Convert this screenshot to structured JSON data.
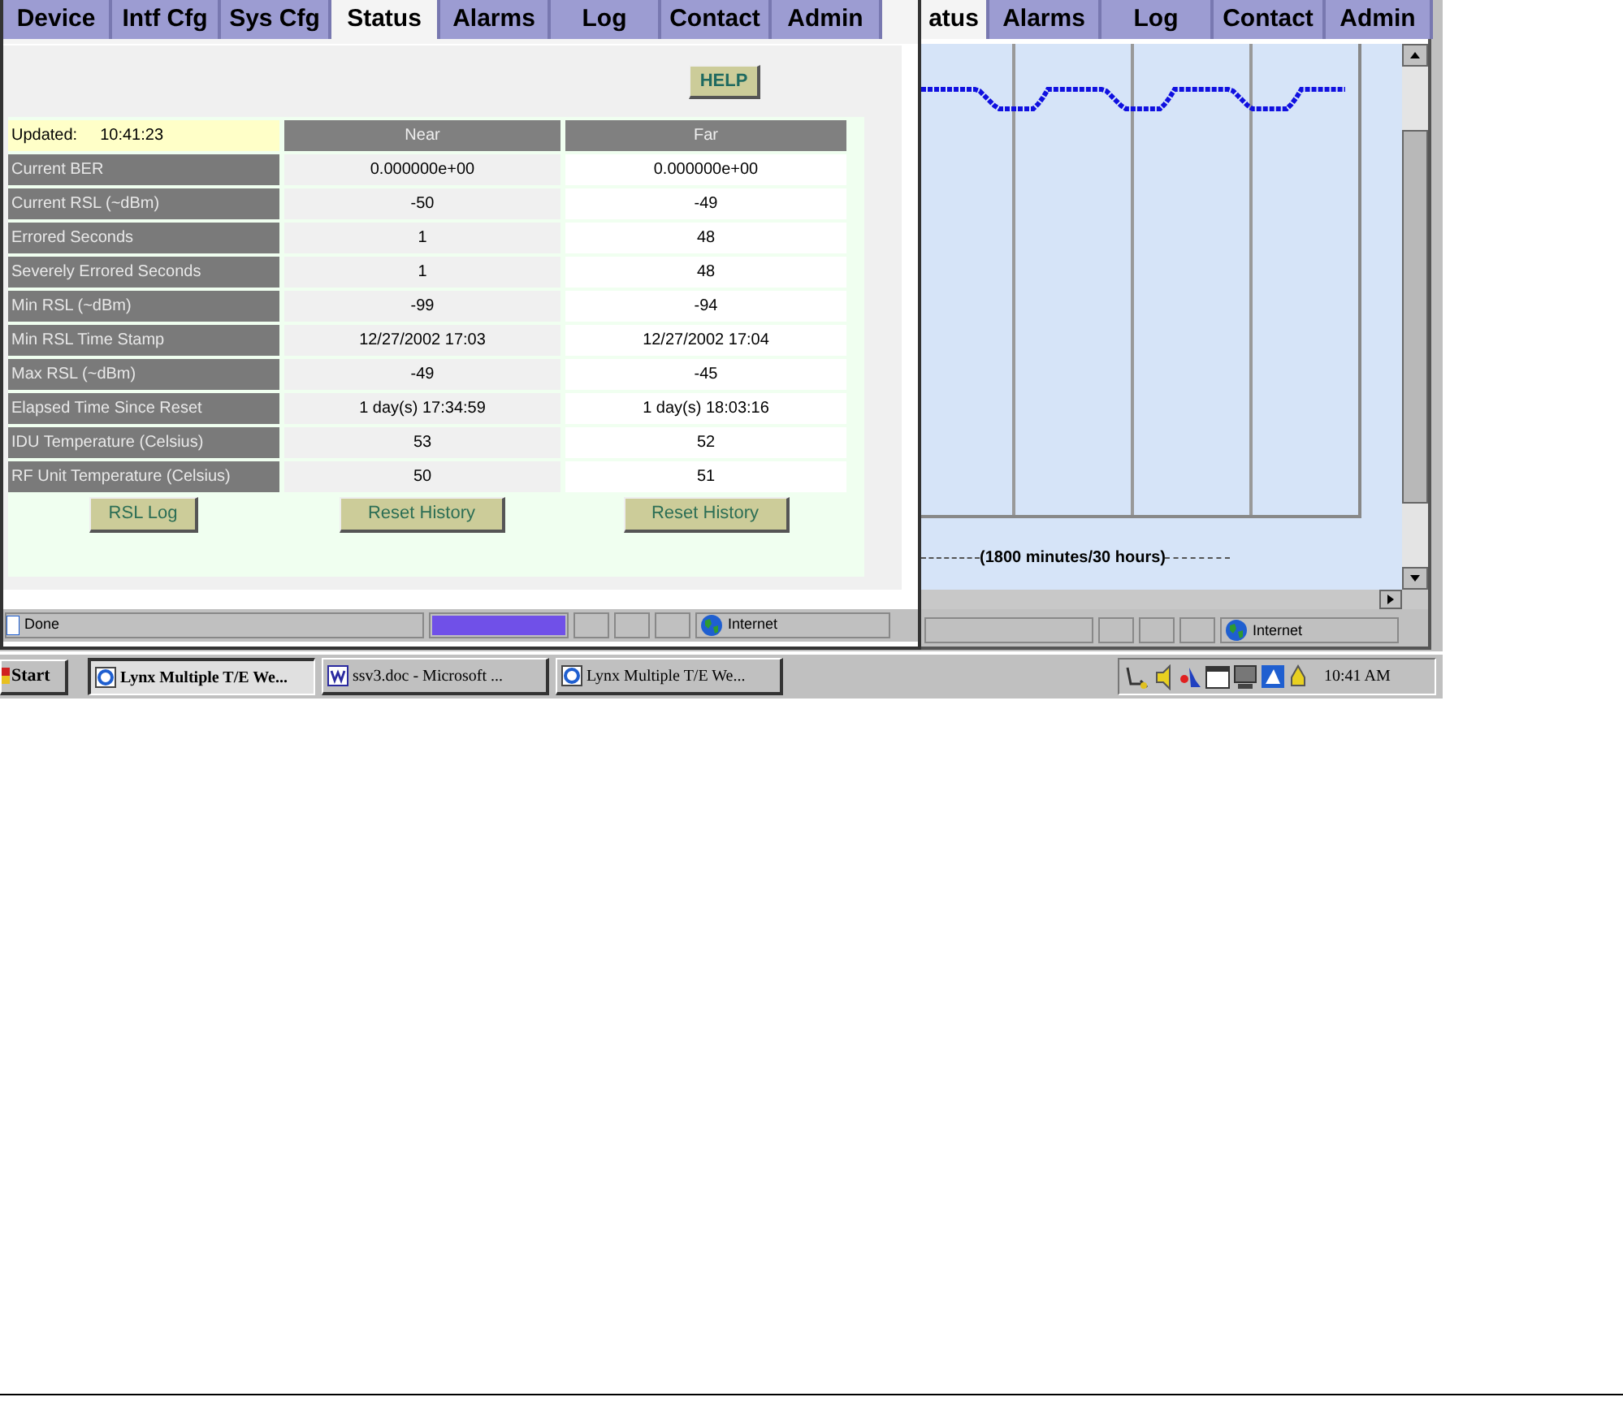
{
  "front_window": {
    "tabs": [
      {
        "label": "Device",
        "selected": false
      },
      {
        "label": "Intf Cfg",
        "selected": false
      },
      {
        "label": "Sys Cfg",
        "selected": false
      },
      {
        "label": "Status",
        "selected": true
      },
      {
        "label": "Alarms",
        "selected": false
      },
      {
        "label": "Log",
        "selected": false
      },
      {
        "label": "Contact",
        "selected": false
      },
      {
        "label": "Admin",
        "selected": false
      }
    ],
    "help_button": "HELP",
    "updated_label": "Updated:",
    "updated_time": "10:41:23",
    "columns": [
      "Near",
      "Far"
    ],
    "rows": [
      {
        "label": "Current BER",
        "near": "0.000000e+00",
        "far": "0.000000e+00"
      },
      {
        "label": "Current RSL (~dBm)",
        "near": "-50",
        "far": "-49"
      },
      {
        "label": "Errored Seconds",
        "near": "1",
        "far": "48"
      },
      {
        "label": "Severely Errored Seconds",
        "near": "1",
        "far": "48"
      },
      {
        "label": "Min RSL (~dBm)",
        "near": "-99",
        "far": "-94"
      },
      {
        "label": "Min RSL Time Stamp",
        "near": "12/27/2002 17:03",
        "far": "12/27/2002 17:04"
      },
      {
        "label": "Max RSL (~dBm)",
        "near": "-49",
        "far": "-45"
      },
      {
        "label": "Elapsed Time Since Reset",
        "near": "1 day(s) 17:34:59",
        "far": "1 day(s) 18:03:16"
      },
      {
        "label": "IDU Temperature (Celsius)",
        "near": "53",
        "far": "52"
      },
      {
        "label": "RF Unit Temperature (Celsius)",
        "near": "50",
        "far": "51"
      }
    ],
    "buttons": [
      "RSL Log",
      "Reset History",
      "Reset History"
    ],
    "status_bar": {
      "text": "Done",
      "progress": {
        "level": 1
      },
      "zone": "Internet"
    }
  },
  "back_window": {
    "tabs": [
      {
        "label": "atus",
        "selected": true
      },
      {
        "label": "Alarms",
        "selected": false
      },
      {
        "label": "Log",
        "selected": false
      },
      {
        "label": "Contact",
        "selected": false
      },
      {
        "label": "Admin",
        "selected": false
      }
    ],
    "chart_caption": "(1800 minutes/30 hours)",
    "status_bar": {
      "zone": "Internet"
    }
  },
  "taskbar": {
    "start": "Start",
    "tasks": [
      {
        "label": "Lynx Multiple T/E We...",
        "kind": "browser",
        "selected": true
      },
      {
        "label": "ssv3.doc - Microsoft ...",
        "kind": "document",
        "selected": false
      },
      {
        "label": "Lynx Multiple T/E We...",
        "kind": "browser",
        "selected": false
      }
    ],
    "clock": "10:41 AM"
  }
}
